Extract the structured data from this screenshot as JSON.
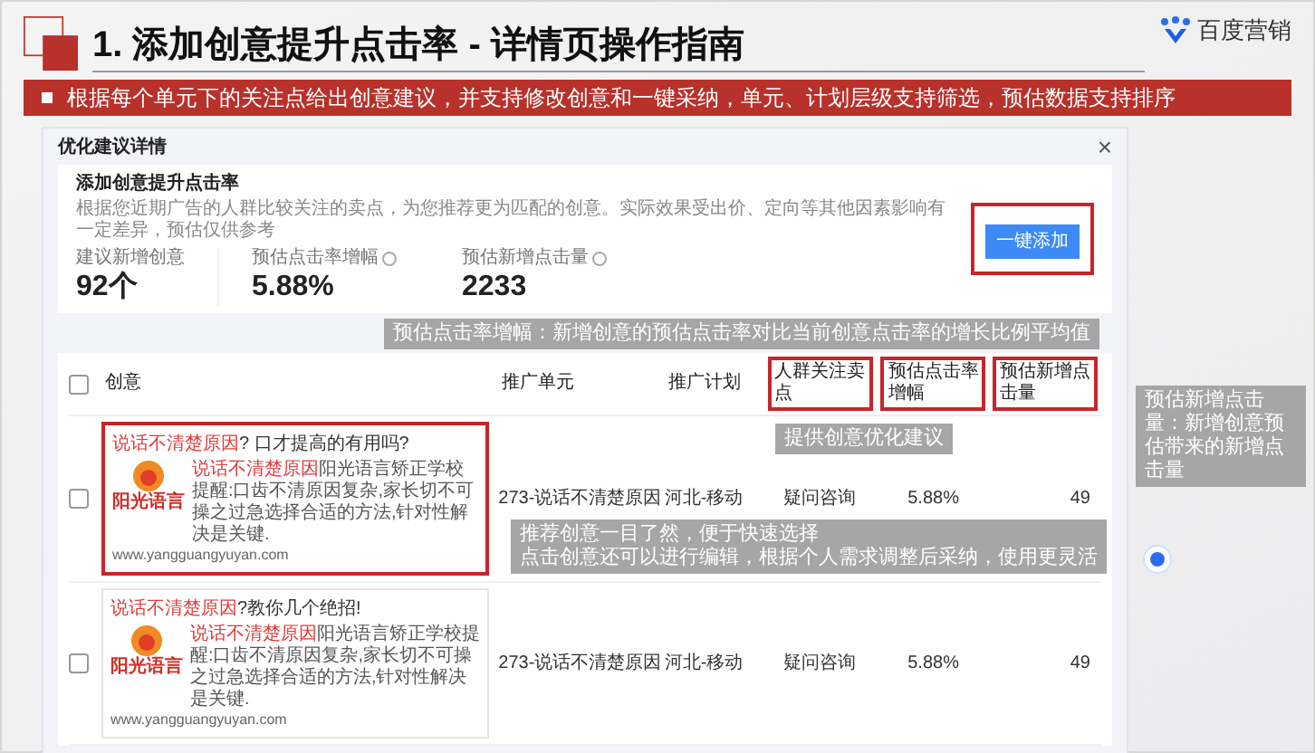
{
  "slide": {
    "title": "1. 添加创意提升点击率 - 详情页操作指南",
    "brand": "百度营销",
    "banner": "根据每个单元下的关注点给出创意建议，并支持修改创意和一键采纳，单元、计划层级支持筛选，预估数据支持排序"
  },
  "dialog": {
    "title": "优化建议详情",
    "close": "×",
    "summary": {
      "heading": "添加创意提升点击率",
      "description": "根据您近期广告的人群比较关注的卖点，为您推荐更为匹配的创意。实际效果受出价、定向等其他因素影响有一定差异，预估仅供参考",
      "stats": [
        {
          "label": "建议新增创意",
          "value": "92个",
          "help": false
        },
        {
          "label": "预估点击率增幅",
          "value": "5.88%",
          "help": true
        },
        {
          "label": "预估新增点击量",
          "value": "2233",
          "help": true
        }
      ],
      "button": "一键添加",
      "button_highlighted": true
    },
    "table": {
      "select_all_checked": false,
      "columns": [
        {
          "label": "创意",
          "highlighted": false
        },
        {
          "label": "推广单元",
          "highlighted": false
        },
        {
          "label": "推广计划",
          "highlighted": false
        },
        {
          "label": "人群关注卖点",
          "highlighted": true
        },
        {
          "label": "预估点击率增幅",
          "highlighted": true
        },
        {
          "label": "预估新增点击量",
          "highlighted": true
        }
      ],
      "rows": [
        {
          "checked": false,
          "highlighted": true,
          "headline_key": "说话不清楚原因",
          "headline_rest": "? 口才提高的有用吗?",
          "logo_text": "阳光语言",
          "body_key": "说话不清楚原因",
          "body_rest": "阳光语言矫正学校提醒:口齿不清原因复杂,家长切不可操之过急选择合适的方法,针对性解决是关键.",
          "url": "www.yangguangyuyan.com",
          "unit": "273-说话不清楚原因",
          "plan": "河北-移动",
          "selling_point": "疑问咨询",
          "ctr_lift": "5.88%",
          "clicks": "49"
        },
        {
          "checked": false,
          "highlighted": false,
          "headline_key": "说话不清楚原因",
          "headline_rest": "?教你几个绝招!",
          "logo_text": "阳光语言",
          "body_key": "说话不清楚原因",
          "body_rest": "阳光语言矫正学校提醒:口齿不清原因复杂,家长切不可操之过急选择合适的方法,针对性解决是关键.",
          "url": "www.yangguangyuyan.com",
          "unit": "273-说话不清楚原因",
          "plan": "河北-移动",
          "selling_point": "疑问咨询",
          "ctr_lift": "5.88%",
          "clicks": "49"
        }
      ]
    }
  },
  "callouts": [
    {
      "lines": [
        "预估点击率增幅：新增创意的预估点击率对比当前创意点击率的增长比例平均值"
      ]
    },
    {
      "lines": [
        "提供创意优化建议"
      ]
    },
    {
      "lines": [
        "推荐创意一目了然，便于快速选择",
        "点击创意还可以进行编辑，根据个人需求调整后采纳，使用更灵活"
      ]
    },
    {
      "lines": [
        "预估新增点击量：新增创意预估带来的新增点击量"
      ]
    }
  ]
}
